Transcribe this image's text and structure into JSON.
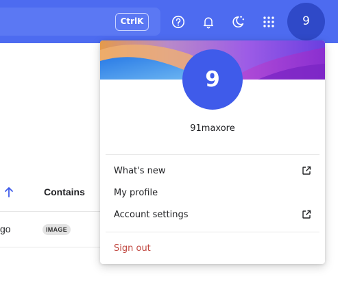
{
  "topbar": {
    "shortcut_label": "CtrlK",
    "avatar_initial": "9",
    "icons": [
      "help-icon",
      "bell-icon",
      "theme-toggle-icon",
      "apps-grid-icon"
    ]
  },
  "table": {
    "column_header": "Contains",
    "row": {
      "cell_text": "go",
      "tag": "IMAGE"
    }
  },
  "account_menu": {
    "avatar_initial": "9",
    "username": "91maxore",
    "items": [
      {
        "label": "What's new"
      },
      {
        "label": "My profile"
      },
      {
        "label": "Account settings"
      }
    ],
    "sign_out_label": "Sign out"
  },
  "colors": {
    "topbar": "#4d6bf0",
    "avatar": "#3f5bea",
    "sign_out": "#c0463f"
  }
}
